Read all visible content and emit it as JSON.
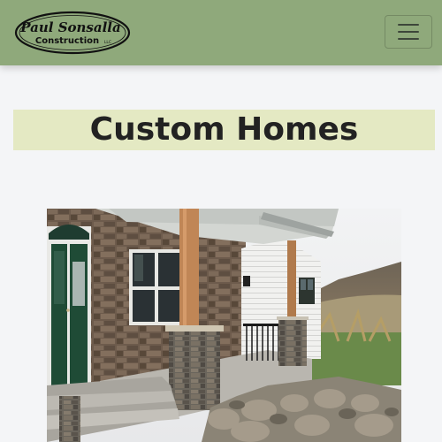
{
  "header": {
    "brand_line1": "Paul Sonsalla",
    "brand_line2": "Construction",
    "brand_suffix": "LLC",
    "menu_toggle_icon": "hamburger-icon",
    "background_color": "#8fa97b"
  },
  "main": {
    "title": "Custom Homes",
    "title_band_color": "#e4e9c3",
    "photo": {
      "subject": "house-front-porch"
    }
  }
}
